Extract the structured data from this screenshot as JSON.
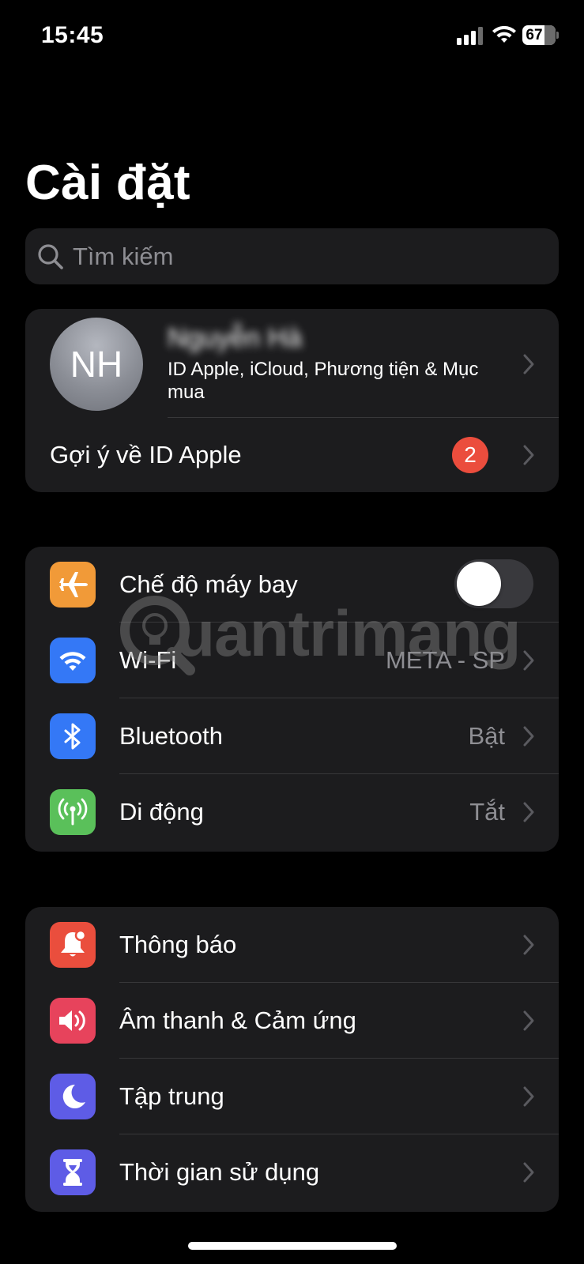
{
  "status_bar": {
    "time": "15:45",
    "battery_level": "67",
    "signal_icon": "cellular-signal-icon",
    "wifi_icon": "wifi-icon"
  },
  "header": {
    "title": "Cài đặt"
  },
  "search": {
    "placeholder": "Tìm kiếm",
    "icon": "search-icon"
  },
  "profile": {
    "initials": "NH",
    "name": "Nguyễn Hà",
    "subtitle": "ID Apple, iCloud, Phương tiện & Mục mua",
    "suggestion_label": "Gợi ý về ID Apple",
    "suggestion_badge": "2"
  },
  "connectivity": [
    {
      "label": "Chế độ máy bay",
      "icon": "airplane-icon",
      "icon_color": "#f19a38",
      "toggle_on": false
    },
    {
      "label": "Wi-Fi",
      "value": "META - SP",
      "icon": "wifi-icon",
      "icon_color": "#3478f6"
    },
    {
      "label": "Bluetooth",
      "value": "Bật",
      "icon": "bluetooth-icon",
      "icon_color": "#3478f6"
    },
    {
      "label": "Di động",
      "value": "Tắt",
      "icon": "cellular-antenna-icon",
      "icon_color": "#5ac05a"
    }
  ],
  "notifications_group": [
    {
      "label": "Thông báo",
      "icon": "bell-icon",
      "icon_color": "#ea4e3d"
    },
    {
      "label": "Âm thanh & Cảm ứng",
      "icon": "speaker-icon",
      "icon_color": "#e7435c"
    },
    {
      "label": "Tập trung",
      "icon": "moon-icon",
      "icon_color": "#5e5ce6"
    },
    {
      "label": "Thời gian sử dụng",
      "icon": "hourglass-icon",
      "icon_color": "#5e5ce6"
    }
  ],
  "watermark": {
    "text": "uantrimang"
  },
  "colors": {
    "background": "#000000",
    "group_background": "#1c1c1e",
    "secondary_text": "#8e8e93",
    "badge": "#eb4d3d"
  }
}
